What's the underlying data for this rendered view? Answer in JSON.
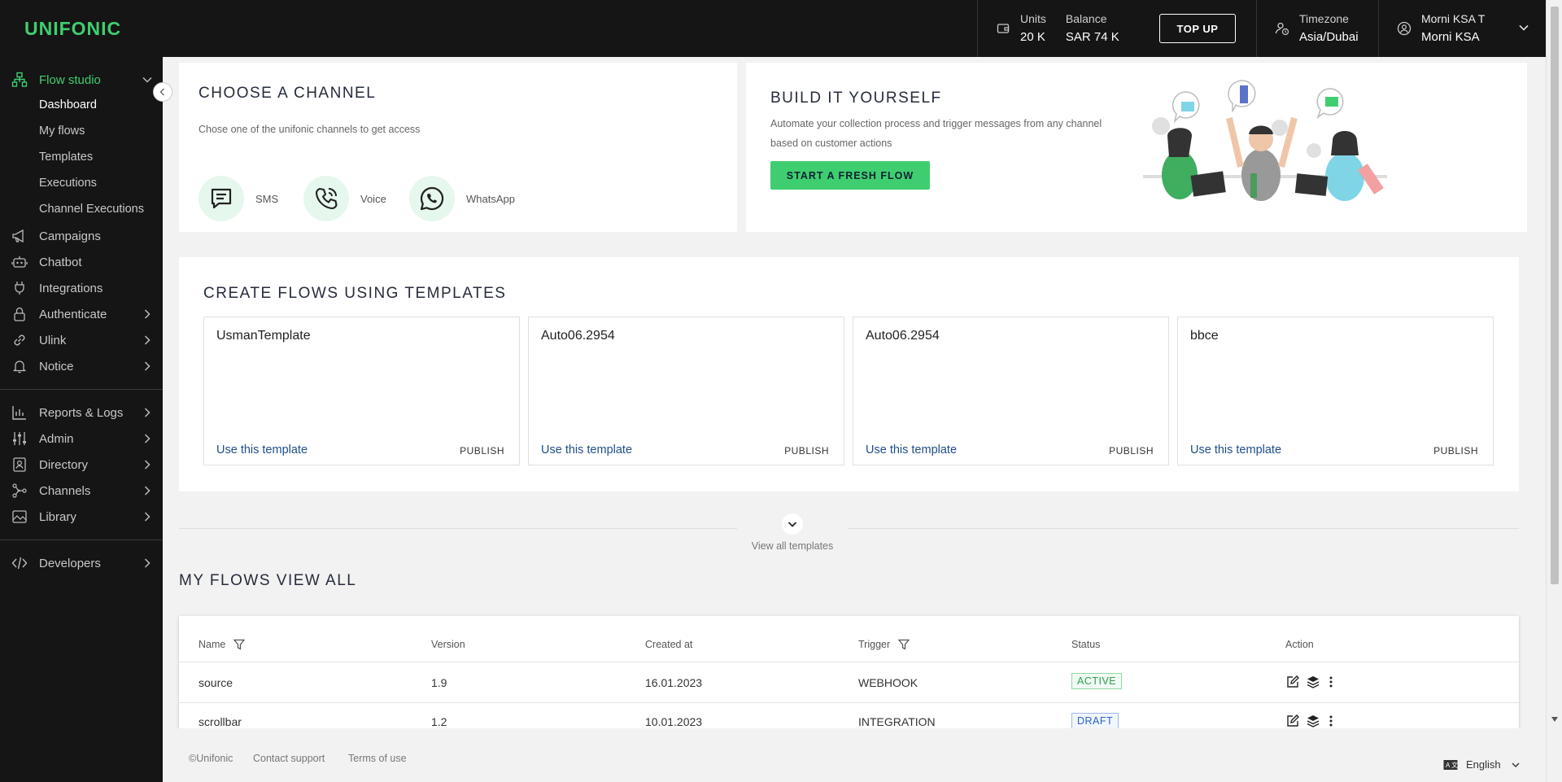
{
  "header": {
    "logo": "UNIFONIC",
    "units_label": "Units",
    "units_value": "20 K",
    "balance_label": "Balance",
    "balance_value": "SAR 74 K",
    "topup_label": "TOP UP",
    "timezone_label": "Timezone",
    "timezone_value": "Asia/Dubai",
    "user_line1": "Morni KSA T",
    "user_line2": "Morni KSA"
  },
  "sidebar": {
    "flow_studio": "Flow studio",
    "sub": [
      "Dashboard",
      "My flows",
      "Templates",
      "Executions",
      "Channel Executions"
    ],
    "items1": [
      "Campaigns",
      "Chatbot",
      "Integrations",
      "Authenticate",
      "Ulink",
      "Notice"
    ],
    "items2": [
      "Reports & Logs",
      "Admin",
      "Directory",
      "Channels",
      "Library"
    ],
    "items3": [
      "Developers"
    ]
  },
  "channel_card": {
    "title": "CHOOSE A CHANNEL",
    "subtitle": "Chose one of the unifonic channels to get access",
    "channels": [
      "SMS",
      "Voice",
      "WhatsApp"
    ]
  },
  "build_card": {
    "title": "BUILD IT YOURSELF",
    "desc_line1": "Automate your collection process and trigger messages from any channel",
    "desc_line2": "based on customer actions",
    "button": "START A FRESH FLOW"
  },
  "templates": {
    "title": "CREATE FLOWS USING TEMPLATES",
    "items": [
      {
        "name": "UsmanTemplate",
        "use": "Use this template",
        "publish": "PUBLISH"
      },
      {
        "name": "Auto06.2954",
        "use": "Use this template",
        "publish": "PUBLISH"
      },
      {
        "name": "Auto06.2954",
        "use": "Use this template",
        "publish": "PUBLISH"
      },
      {
        "name": "bbce",
        "use": "Use this template",
        "publish": "PUBLISH"
      }
    ],
    "view_all": "View all templates"
  },
  "my_flows": {
    "title": "MY FLOWS VIEW ALL",
    "columns": [
      "Name",
      "Version",
      "Created at",
      "Trigger",
      "Status",
      "Action"
    ],
    "rows": [
      {
        "name": "source",
        "version": "1.9",
        "created": "16.01.2023",
        "trigger": "WEBHOOK",
        "status": "ACTIVE"
      },
      {
        "name": "scrollbar",
        "version": "1.2",
        "created": "10.01.2023",
        "trigger": "INTEGRATION",
        "status": "DRAFT"
      }
    ]
  },
  "footer": {
    "copyright": "©Unifonic",
    "contact": "Contact support",
    "terms": "Terms of use",
    "language": "English"
  },
  "colors": {
    "accent": "#3fce6f",
    "dark": "#151515",
    "link": "#1f4e8c"
  }
}
